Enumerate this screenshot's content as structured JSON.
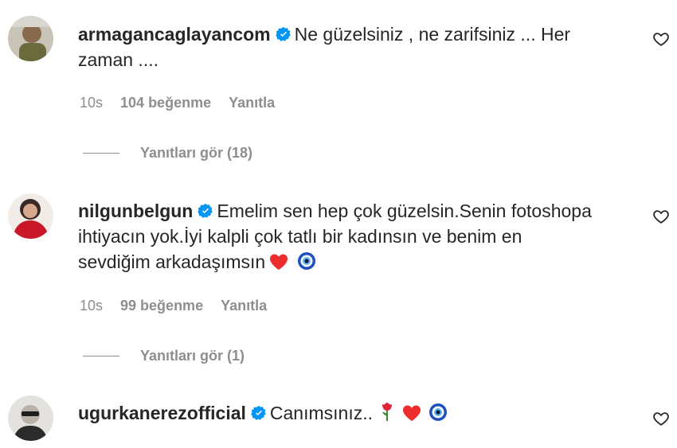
{
  "comments": [
    {
      "username": "armagancaglayancom",
      "text_line1": "Ne güzelsiniz , ne zarifsiniz ... Her",
      "text_line2": "zaman ....",
      "time": "10s",
      "likes": "104 beğenme",
      "reply_label": "Yanıtla",
      "view_replies": "Yanıtları gör (18)"
    },
    {
      "username": "nilgunbelgun",
      "text_line1": "Emelim sen hep çok güzelsin.Senin fotoshopa",
      "text_line2": "ihtiyacın yok.İyi kalpli çok tatlı bir kadınsın ve benim en",
      "text_line3": "sevdiğim arkadaşımsın",
      "time": "10s",
      "likes": "99 beğenme",
      "reply_label": "Yanıtla",
      "view_replies": "Yanıtları gör (1)"
    },
    {
      "username": "ugurkanerezofficial",
      "text_line1": "Canımsınız.."
    }
  ],
  "colors": {
    "verified": "#0095f6",
    "text": "#262626",
    "secondary": "#8e8e8e",
    "heart_emoji": "#ed2d2d"
  },
  "icons": [
    "verified-badge-icon",
    "heart-outline-icon",
    "red-heart-emoji",
    "nazar-eye-emoji",
    "rose-emoji"
  ]
}
